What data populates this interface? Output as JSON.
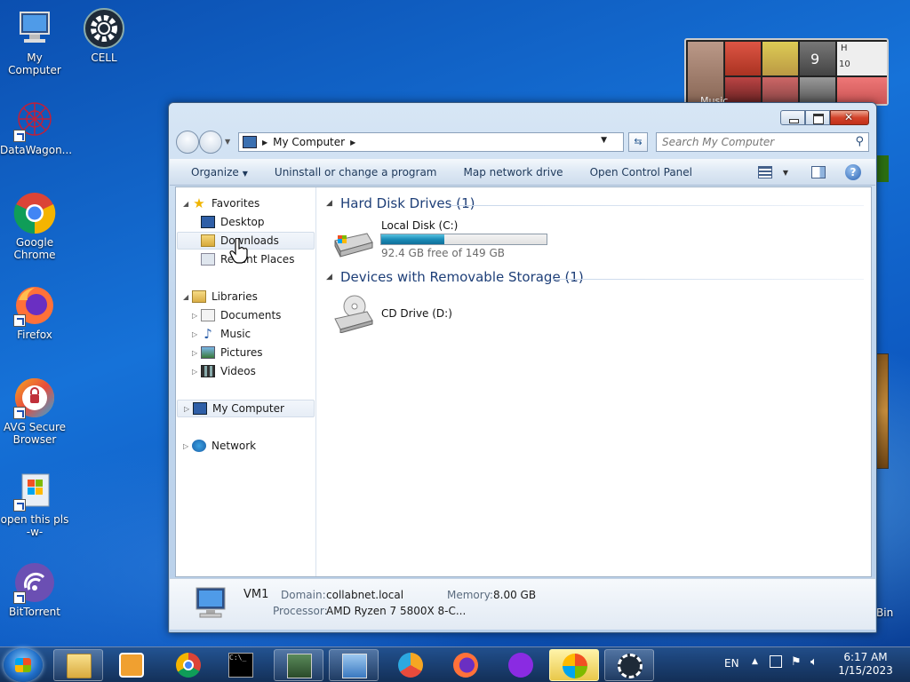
{
  "desktop": {
    "icons": [
      {
        "label": "My Computer"
      },
      {
        "label": "CELL"
      },
      {
        "label": "DataWagon..."
      },
      {
        "label": "Google Chrome"
      },
      {
        "label": "Firefox"
      },
      {
        "label": "AVG Secure Browser"
      },
      {
        "label": "open this pls -w-"
      },
      {
        "label": "BitTorrent"
      }
    ],
    "partial_label": "Bin",
    "gadget": {
      "label": "Music",
      "clock_digit": "9",
      "clock_letter": "H",
      "clock_number": "10"
    }
  },
  "window": {
    "address": {
      "location": "My Computer"
    },
    "search": {
      "placeholder": "Search My Computer"
    },
    "toolbar": {
      "organize": "Organize",
      "uninstall": "Uninstall or change a program",
      "map_drive": "Map network drive",
      "control_panel": "Open Control Panel"
    },
    "nav": {
      "favorites": "Favorites",
      "desktop": "Desktop",
      "downloads": "Downloads",
      "recent": "Recent Places",
      "libraries": "Libraries",
      "documents": "Documents",
      "music": "Music",
      "pictures": "Pictures",
      "videos": "Videos",
      "my_computer": "My Computer",
      "network": "Network"
    },
    "content": {
      "hdd_group": "Hard Disk Drives (1)",
      "local_disk_name": "Local Disk (C:)",
      "local_disk_free": "92.4 GB free of 149 GB",
      "local_disk_used_fraction": 0.38,
      "removable_group": "Devices with Removable Storage (1)",
      "cd_name": "CD Drive (D:)"
    },
    "details": {
      "name": "VM1",
      "domain_label": "Domain:",
      "domain": "collabnet.local",
      "memory_label": "Memory:",
      "memory": "8.00 GB",
      "processor_label": "Processor:",
      "processor": "AMD Ryzen 7 5800X 8-C..."
    }
  },
  "taskbar": {
    "language": "EN",
    "time": "6:17 AM",
    "date": "1/15/2023"
  },
  "colors": {
    "accent": "#1e3f78",
    "progress": "#1b8cb8",
    "desktop": "#1672d8"
  }
}
